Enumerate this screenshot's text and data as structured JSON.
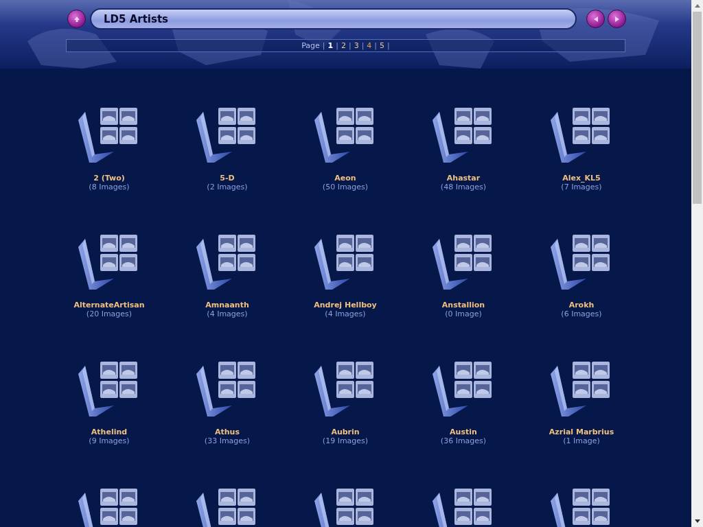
{
  "header": {
    "title": "LD5 Artists"
  },
  "pagination": {
    "label": "Page",
    "separator": "|",
    "pages": [
      {
        "label": "1",
        "selected": true,
        "visited": false
      },
      {
        "label": "2",
        "selected": false,
        "visited": false
      },
      {
        "label": "3",
        "selected": false,
        "visited": false
      },
      {
        "label": "4",
        "selected": false,
        "visited": true
      },
      {
        "label": "5",
        "selected": false,
        "visited": false
      }
    ]
  },
  "albums": [
    {
      "kind": "album",
      "name": "2 (Two)",
      "count": "(8 Images)"
    },
    {
      "kind": "album",
      "name": "5-D",
      "count": "(2 Images)"
    },
    {
      "kind": "album",
      "name": "Aeon",
      "count": "(50 Images)"
    },
    {
      "kind": "album",
      "name": "Ahastar",
      "count": "(48 Images)"
    },
    {
      "kind": "album",
      "name": "Alex_KL5",
      "count": "(7 Images)"
    },
    {
      "kind": "album",
      "name": "AlternateArtisan",
      "count": "(20 Images)"
    },
    {
      "kind": "album",
      "name": "Amnaanth",
      "count": "(4 Images)"
    },
    {
      "kind": "album",
      "name": "Andrej Hellboy",
      "count": "(4 Images)"
    },
    {
      "kind": "album",
      "name": "Anstallion",
      "count": "(0 Image)"
    },
    {
      "kind": "album",
      "name": "Arokh",
      "count": "(6 Images)"
    },
    {
      "kind": "album",
      "name": "Athelind",
      "count": "(9 Images)"
    },
    {
      "kind": "album",
      "name": "Athus",
      "count": "(33 Images)"
    },
    {
      "kind": "album",
      "name": "Aubrin",
      "count": "(19 Images)"
    },
    {
      "kind": "album",
      "name": "Austin",
      "count": "(36 Images)"
    },
    {
      "kind": "album",
      "name": "Azrial Marbrius",
      "count": "(1 Image)"
    },
    {
      "kind": "album_cut"
    },
    {
      "kind": "album_cut"
    },
    {
      "kind": "album_cut"
    },
    {
      "kind": "album_cut"
    },
    {
      "kind": "album_cut"
    }
  ]
}
